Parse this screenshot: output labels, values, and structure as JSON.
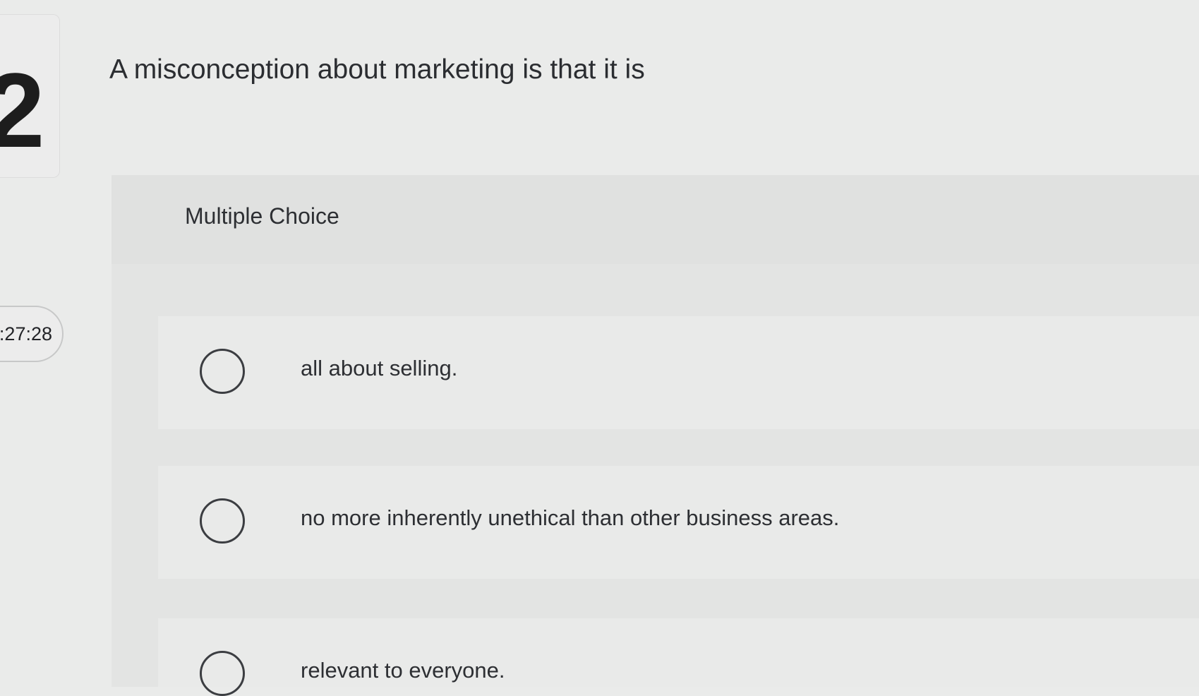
{
  "sidebar": {
    "question_number": "2",
    "timer": ":27:28"
  },
  "question": {
    "text": "A misconception about marketing is that it is"
  },
  "multiple_choice": {
    "label": "Multiple Choice",
    "options": [
      {
        "label": "all about selling.",
        "selected": false
      },
      {
        "label": "no more inherently unethical than other business areas.",
        "selected": false
      },
      {
        "label": "relevant to everyone.",
        "selected": false
      }
    ]
  }
}
